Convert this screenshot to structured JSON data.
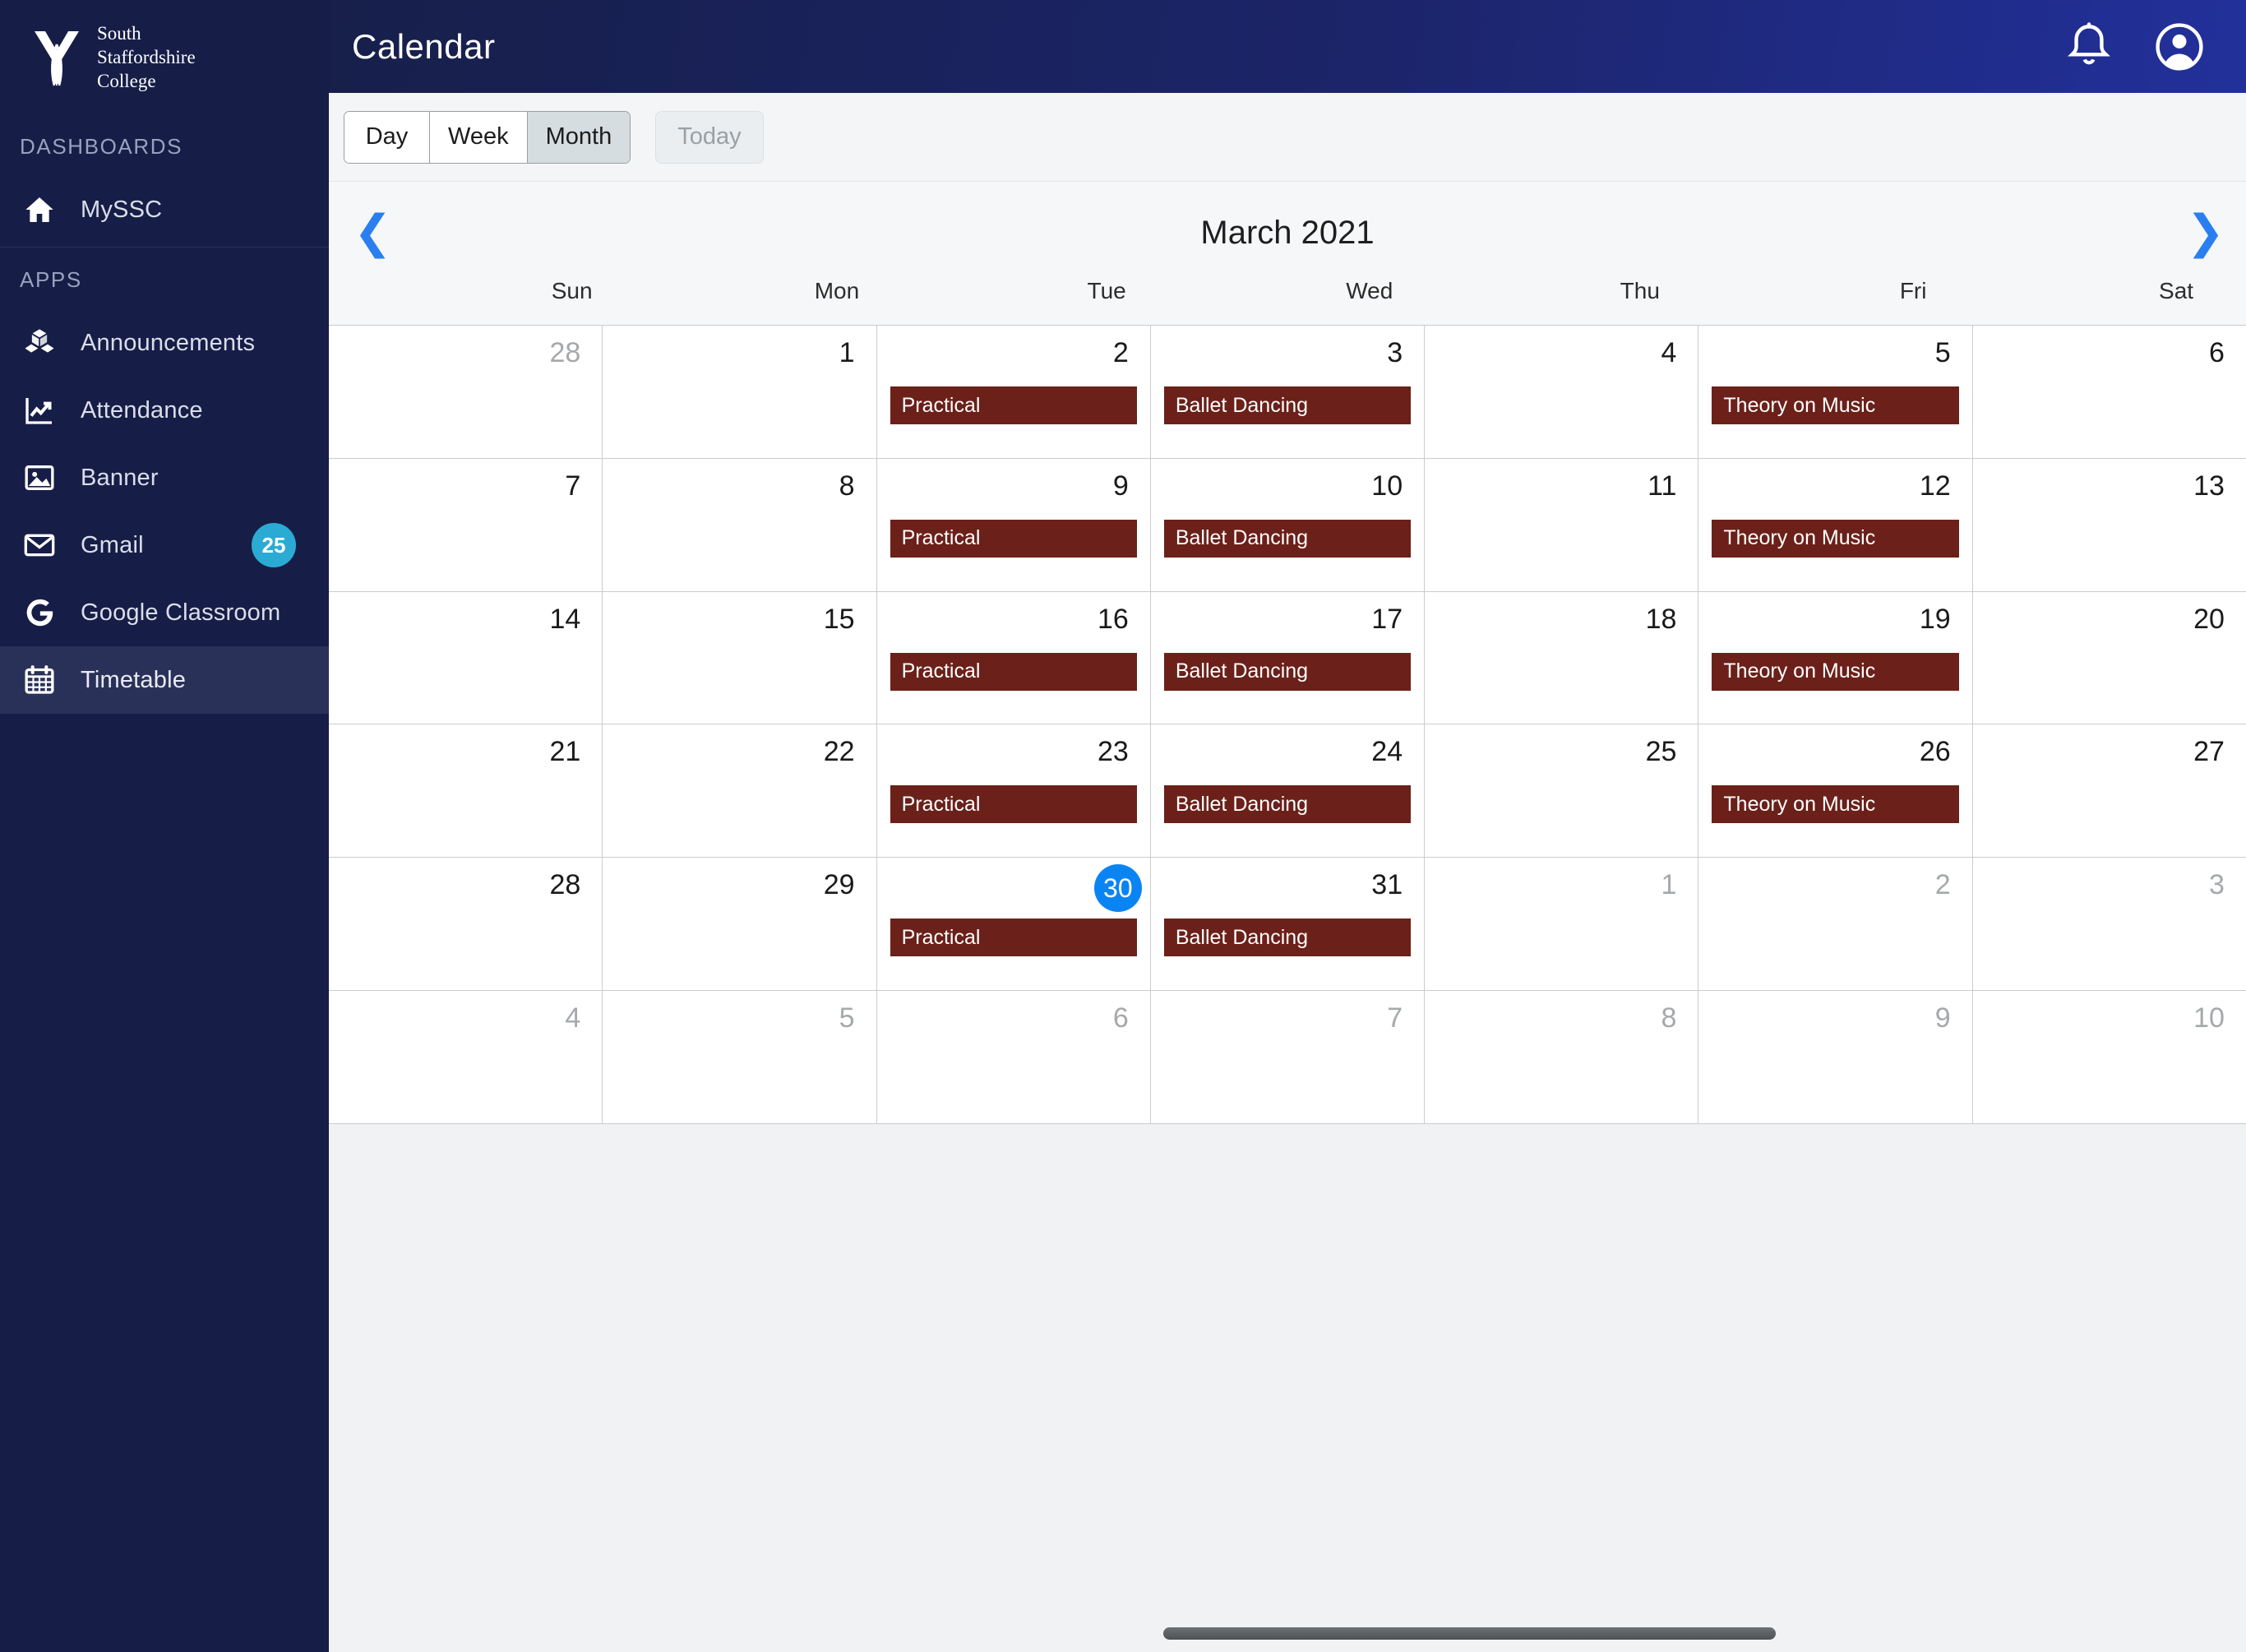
{
  "sidebar": {
    "brand": {
      "name": "South\nStaffordshire\nCollege",
      "logo_icon": "ssc-logo-icon"
    },
    "sections": [
      {
        "label": "DASHBOARDS",
        "items": [
          {
            "label": "MySSC",
            "icon": "home-icon",
            "badge": null,
            "active": false
          }
        ]
      },
      {
        "label": "APPS",
        "items": [
          {
            "label": "Announcements",
            "icon": "boxes-icon",
            "badge": null,
            "active": false
          },
          {
            "label": "Attendance",
            "icon": "chart-line-icon",
            "badge": null,
            "active": false
          },
          {
            "label": "Banner",
            "icon": "image-icon",
            "badge": null,
            "active": false
          },
          {
            "label": "Gmail",
            "icon": "envelope-icon",
            "badge": "25",
            "active": false
          },
          {
            "label": "Google Classroom",
            "icon": "google-g-icon",
            "badge": null,
            "active": false
          },
          {
            "label": "Timetable",
            "icon": "calendar-icon",
            "badge": null,
            "active": true
          }
        ]
      }
    ]
  },
  "topbar": {
    "title": "Calendar",
    "notifications_icon": "bell-icon",
    "account_icon": "user-circle-icon"
  },
  "toolbar": {
    "views": [
      {
        "label": "Day",
        "selected": false
      },
      {
        "label": "Week",
        "selected": false
      },
      {
        "label": "Month",
        "selected": true
      }
    ],
    "today_label": "Today"
  },
  "calendar": {
    "title": "March 2021",
    "prev_icon": "chevron-left-icon",
    "next_icon": "chevron-right-icon",
    "day_names": [
      "Sun",
      "Mon",
      "Tue",
      "Wed",
      "Thu",
      "Fri",
      "Sat"
    ],
    "weeks": [
      [
        {
          "num": "28",
          "other": true,
          "today": false,
          "event": null
        },
        {
          "num": "1",
          "other": false,
          "today": false,
          "event": null
        },
        {
          "num": "2",
          "other": false,
          "today": false,
          "event": "Practical"
        },
        {
          "num": "3",
          "other": false,
          "today": false,
          "event": "Ballet Dancing"
        },
        {
          "num": "4",
          "other": false,
          "today": false,
          "event": null
        },
        {
          "num": "5",
          "other": false,
          "today": false,
          "event": "Theory on Music"
        },
        {
          "num": "6",
          "other": false,
          "today": false,
          "event": null
        }
      ],
      [
        {
          "num": "7",
          "other": false,
          "today": false,
          "event": null
        },
        {
          "num": "8",
          "other": false,
          "today": false,
          "event": null
        },
        {
          "num": "9",
          "other": false,
          "today": false,
          "event": "Practical"
        },
        {
          "num": "10",
          "other": false,
          "today": false,
          "event": "Ballet Dancing"
        },
        {
          "num": "11",
          "other": false,
          "today": false,
          "event": null
        },
        {
          "num": "12",
          "other": false,
          "today": false,
          "event": "Theory on Music"
        },
        {
          "num": "13",
          "other": false,
          "today": false,
          "event": null
        }
      ],
      [
        {
          "num": "14",
          "other": false,
          "today": false,
          "event": null
        },
        {
          "num": "15",
          "other": false,
          "today": false,
          "event": null
        },
        {
          "num": "16",
          "other": false,
          "today": false,
          "event": "Practical"
        },
        {
          "num": "17",
          "other": false,
          "today": false,
          "event": "Ballet Dancing"
        },
        {
          "num": "18",
          "other": false,
          "today": false,
          "event": null
        },
        {
          "num": "19",
          "other": false,
          "today": false,
          "event": "Theory on Music"
        },
        {
          "num": "20",
          "other": false,
          "today": false,
          "event": null
        }
      ],
      [
        {
          "num": "21",
          "other": false,
          "today": false,
          "event": null
        },
        {
          "num": "22",
          "other": false,
          "today": false,
          "event": null
        },
        {
          "num": "23",
          "other": false,
          "today": false,
          "event": "Practical"
        },
        {
          "num": "24",
          "other": false,
          "today": false,
          "event": "Ballet Dancing"
        },
        {
          "num": "25",
          "other": false,
          "today": false,
          "event": null
        },
        {
          "num": "26",
          "other": false,
          "today": false,
          "event": "Theory on Music"
        },
        {
          "num": "27",
          "other": false,
          "today": false,
          "event": null
        }
      ],
      [
        {
          "num": "28",
          "other": false,
          "today": false,
          "event": null
        },
        {
          "num": "29",
          "other": false,
          "today": false,
          "event": null
        },
        {
          "num": "30",
          "other": false,
          "today": true,
          "event": "Practical"
        },
        {
          "num": "31",
          "other": false,
          "today": false,
          "event": "Ballet Dancing"
        },
        {
          "num": "1",
          "other": true,
          "today": false,
          "event": null
        },
        {
          "num": "2",
          "other": true,
          "today": false,
          "event": null
        },
        {
          "num": "3",
          "other": true,
          "today": false,
          "event": null
        }
      ],
      [
        {
          "num": "4",
          "other": true,
          "today": false,
          "event": null
        },
        {
          "num": "5",
          "other": true,
          "today": false,
          "event": null
        },
        {
          "num": "6",
          "other": true,
          "today": false,
          "event": null
        },
        {
          "num": "7",
          "other": true,
          "today": false,
          "event": null
        },
        {
          "num": "8",
          "other": true,
          "today": false,
          "event": null
        },
        {
          "num": "9",
          "other": true,
          "today": false,
          "event": null
        },
        {
          "num": "10",
          "other": true,
          "today": false,
          "event": null
        }
      ]
    ]
  },
  "colors": {
    "sidebar_bg": "#161E47",
    "sidebar_active": "#2A3159",
    "badge": "#2BABD4",
    "event": "#6B2019",
    "today_circle": "#0B84F3",
    "nav_arrow": "#2A7FF0",
    "page_bg": "#F0F2F4"
  },
  "scrollbar": {
    "icon": "horizontal-scrollbar-thumb"
  }
}
